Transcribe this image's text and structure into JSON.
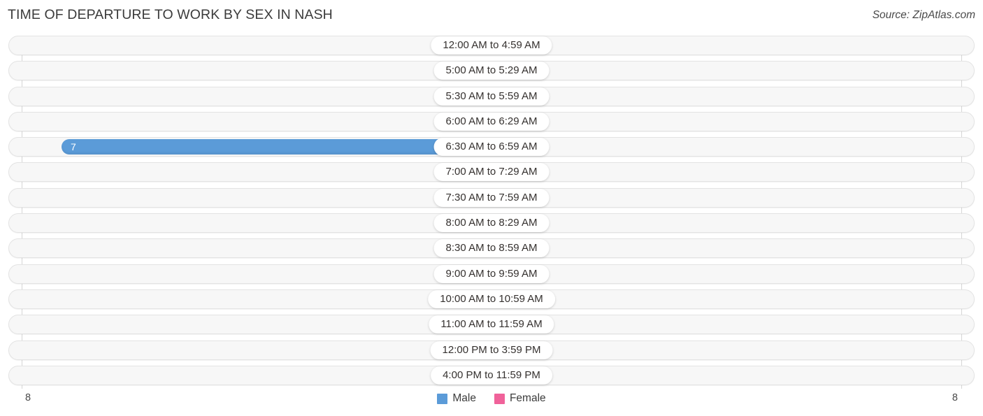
{
  "header": {
    "title": "TIME OF DEPARTURE TO WORK BY SEX IN NASH",
    "source": "Source: ZipAtlas.com"
  },
  "legend": {
    "male": {
      "label": "Male",
      "color": "#5b9bd8"
    },
    "female": {
      "label": "Female",
      "color": "#f0629a"
    }
  },
  "axis": {
    "left_label": "8",
    "right_label": "8"
  },
  "chart_data": {
    "type": "bar",
    "title": "TIME OF DEPARTURE TO WORK BY SEX IN NASH",
    "orientation": "horizontal-diverging",
    "xlabel": "",
    "ylabel": "",
    "xlim": [
      0,
      8
    ],
    "grid": false,
    "legend_position": "bottom-center",
    "categories": [
      "12:00 AM to 4:59 AM",
      "5:00 AM to 5:29 AM",
      "5:30 AM to 5:59 AM",
      "6:00 AM to 6:29 AM",
      "6:30 AM to 6:59 AM",
      "7:00 AM to 7:29 AM",
      "7:30 AM to 7:59 AM",
      "8:00 AM to 8:29 AM",
      "8:30 AM to 8:59 AM",
      "9:00 AM to 9:59 AM",
      "10:00 AM to 10:59 AM",
      "11:00 AM to 11:59 AM",
      "12:00 PM to 3:59 PM",
      "4:00 PM to 11:59 PM"
    ],
    "series": [
      {
        "name": "Male",
        "color": "#5b9bd8",
        "values": [
          0,
          0,
          0,
          0,
          7,
          0,
          0,
          0,
          0,
          0,
          0,
          0,
          0,
          0
        ]
      },
      {
        "name": "Female",
        "color": "#f0629a",
        "values": [
          0,
          0,
          0,
          0,
          0,
          0,
          0,
          0,
          0,
          0,
          0,
          0,
          0,
          0
        ]
      }
    ]
  },
  "rows": [
    {
      "label": "12:00 AM to 4:59 AM",
      "male": "0",
      "female": "0",
      "male_pct": 0,
      "female_pct": 0
    },
    {
      "label": "5:00 AM to 5:29 AM",
      "male": "0",
      "female": "0",
      "male_pct": 0,
      "female_pct": 0
    },
    {
      "label": "5:30 AM to 5:59 AM",
      "male": "0",
      "female": "0",
      "male_pct": 0,
      "female_pct": 0
    },
    {
      "label": "6:00 AM to 6:29 AM",
      "male": "0",
      "female": "0",
      "male_pct": 0,
      "female_pct": 0
    },
    {
      "label": "6:30 AM to 6:59 AM",
      "male": "7",
      "female": "0",
      "male_pct": 100,
      "female_pct": 0
    },
    {
      "label": "7:00 AM to 7:29 AM",
      "male": "0",
      "female": "0",
      "male_pct": 0,
      "female_pct": 0
    },
    {
      "label": "7:30 AM to 7:59 AM",
      "male": "0",
      "female": "0",
      "male_pct": 0,
      "female_pct": 0
    },
    {
      "label": "8:00 AM to 8:29 AM",
      "male": "0",
      "female": "0",
      "male_pct": 0,
      "female_pct": 0
    },
    {
      "label": "8:30 AM to 8:59 AM",
      "male": "0",
      "female": "0",
      "male_pct": 0,
      "female_pct": 0
    },
    {
      "label": "9:00 AM to 9:59 AM",
      "male": "0",
      "female": "0",
      "male_pct": 0,
      "female_pct": 0
    },
    {
      "label": "10:00 AM to 10:59 AM",
      "male": "0",
      "female": "0",
      "male_pct": 0,
      "female_pct": 0
    },
    {
      "label": "11:00 AM to 11:59 AM",
      "male": "0",
      "female": "0",
      "male_pct": 0,
      "female_pct": 0
    },
    {
      "label": "12:00 PM to 3:59 PM",
      "male": "0",
      "female": "0",
      "male_pct": 0,
      "female_pct": 0
    },
    {
      "label": "4:00 PM to 11:59 PM",
      "male": "0",
      "female": "0",
      "male_pct": 0,
      "female_pct": 0
    }
  ]
}
